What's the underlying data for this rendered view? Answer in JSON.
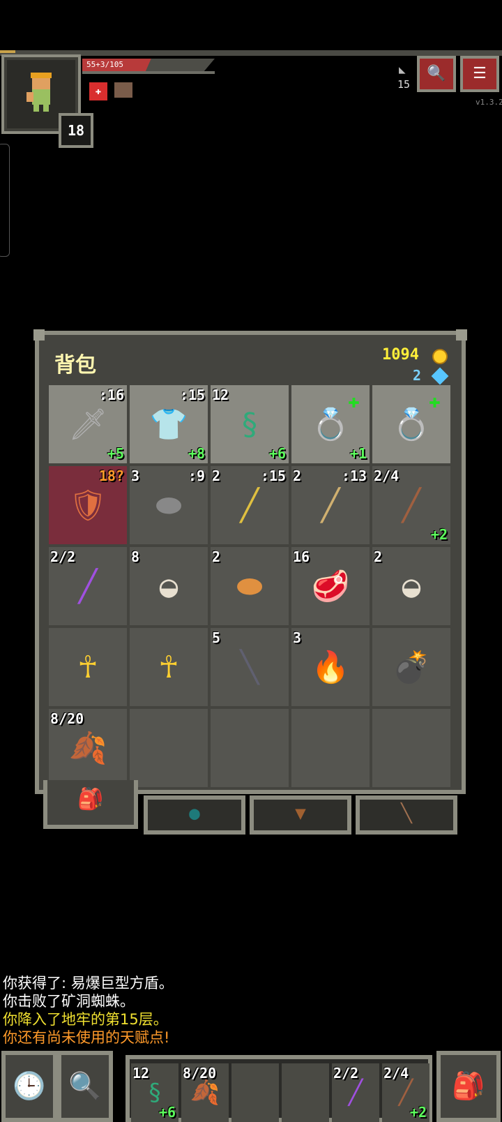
{
  "status": {
    "hp_text": "55+3/105",
    "hp_fraction": 0.52,
    "level": "18",
    "depth": "15",
    "version": "v1.3.2",
    "icons": {
      "portrait": "hero-portrait-icon",
      "depth": "stairs-icon",
      "journal": "journal-icon",
      "menu": "menu-icon"
    }
  },
  "inventory": {
    "title": "背包",
    "gold": "1094",
    "gems": "2",
    "rows": [
      [
        {
          "name": "sword",
          "glyph": "🗡",
          "qty": "",
          "lvl": ":16",
          "bonus": "+5",
          "plus": false,
          "state": "equipped"
        },
        {
          "name": "armor",
          "glyph": "👕",
          "qty": "",
          "lvl": ":15",
          "bonus": "+8",
          "plus": false,
          "state": "equipped"
        },
        {
          "name": "artifact-chain",
          "glyph": "§",
          "qty": "12",
          "lvl": "",
          "bonus": "+6",
          "plus": false,
          "state": "equipped"
        },
        {
          "name": "ring-1",
          "glyph": "💍",
          "qty": "",
          "lvl": "",
          "bonus": "+1",
          "plus": true,
          "state": "equipped"
        },
        {
          "name": "ring-2",
          "glyph": "💍",
          "qty": "",
          "lvl": "",
          "bonus": "",
          "plus": true,
          "state": "equipped"
        }
      ],
      [
        {
          "name": "tower-shield",
          "glyph": "🛡",
          "qty": "",
          "lvl": "18?",
          "bonus": "",
          "plus": false,
          "state": "cursed"
        },
        {
          "name": "stone",
          "glyph": "⬬",
          "qty": "3",
          "lvl": ":9",
          "bonus": "",
          "plus": false,
          "state": ""
        },
        {
          "name": "spear",
          "glyph": "╱",
          "qty": "2",
          "lvl": ":15",
          "bonus": "",
          "plus": false,
          "state": ""
        },
        {
          "name": "javelin",
          "glyph": "╱",
          "qty": "2",
          "lvl": ":13",
          "bonus": "",
          "plus": false,
          "state": ""
        },
        {
          "name": "wand-brown",
          "glyph": "╱",
          "qty": "2/4",
          "lvl": "",
          "bonus": "+2",
          "plus": false,
          "state": ""
        }
      ],
      [
        {
          "name": "wand-purple",
          "glyph": "╱",
          "qty": "2/2",
          "lvl": "",
          "bonus": "",
          "plus": false,
          "state": ""
        },
        {
          "name": "pasty",
          "glyph": "◒",
          "qty": "8",
          "lvl": "",
          "bonus": "",
          "plus": false,
          "state": ""
        },
        {
          "name": "bread",
          "glyph": "⬬",
          "qty": "2",
          "lvl": "",
          "bonus": "",
          "plus": false,
          "state": ""
        },
        {
          "name": "meat",
          "glyph": "🥩",
          "qty": "16",
          "lvl": "",
          "bonus": "",
          "plus": false,
          "state": ""
        },
        {
          "name": "pasty-2",
          "glyph": "◒",
          "qty": "2",
          "lvl": "",
          "bonus": "",
          "plus": false,
          "state": ""
        }
      ],
      [
        {
          "name": "ankh-1",
          "glyph": "☥",
          "qty": "",
          "lvl": "",
          "bonus": "",
          "plus": false,
          "state": ""
        },
        {
          "name": "ankh-2",
          "glyph": "☥",
          "qty": "",
          "lvl": "",
          "bonus": "",
          "plus": false,
          "state": ""
        },
        {
          "name": "dart",
          "glyph": "╲",
          "qty": "5",
          "lvl": "",
          "bonus": "",
          "plus": false,
          "state": ""
        },
        {
          "name": "torch",
          "glyph": "🔥",
          "qty": "3",
          "lvl": "",
          "bonus": "",
          "plus": false,
          "state": ""
        },
        {
          "name": "bomb",
          "glyph": "💣",
          "qty": "",
          "lvl": "",
          "bonus": "",
          "plus": false,
          "state": ""
        }
      ],
      [
        {
          "name": "waterskin",
          "glyph": "🍂",
          "qty": "8/20",
          "lvl": "",
          "bonus": "",
          "plus": false,
          "state": ""
        },
        {
          "name": "empty",
          "glyph": "",
          "qty": "",
          "lvl": "",
          "bonus": "",
          "plus": false,
          "state": ""
        },
        {
          "name": "empty",
          "glyph": "",
          "qty": "",
          "lvl": "",
          "bonus": "",
          "plus": false,
          "state": ""
        },
        {
          "name": "empty",
          "glyph": "",
          "qty": "",
          "lvl": "",
          "bonus": "",
          "plus": false,
          "state": ""
        },
        {
          "name": "empty",
          "glyph": "",
          "qty": "",
          "lvl": "",
          "bonus": "",
          "plus": false,
          "state": ""
        }
      ]
    ],
    "tabs": [
      {
        "icon": "backpack-icon",
        "glyph": "🎒"
      },
      {
        "icon": "seed-pouch-icon",
        "glyph": "●"
      },
      {
        "icon": "scroll-holder-icon",
        "glyph": "▼"
      },
      {
        "icon": "wand-holster-icon",
        "glyph": "╲"
      }
    ]
  },
  "log": [
    {
      "text": "你获得了: 易爆巨型方盾。",
      "color": "#ffffff"
    },
    {
      "text": "你击败了矿洞蜘蛛。",
      "color": "#ffffff"
    },
    {
      "text": "你降入了地牢的第15层。",
      "color": "#f0e030"
    },
    {
      "text": "你还有尚未使用的天赋点!",
      "color": "#ff9a2a"
    }
  ],
  "quickslots": [
    {
      "qty": "12",
      "bonus": "+6",
      "glyph": "§"
    },
    {
      "qty": "8/20",
      "bonus": "",
      "glyph": "🍂"
    },
    {
      "qty": "",
      "bonus": "",
      "glyph": ""
    },
    {
      "qty": "",
      "bonus": "",
      "glyph": ""
    },
    {
      "qty": "2/2",
      "bonus": "",
      "glyph": "╱"
    },
    {
      "qty": "2/4",
      "bonus": "+2",
      "glyph": "╱"
    }
  ]
}
